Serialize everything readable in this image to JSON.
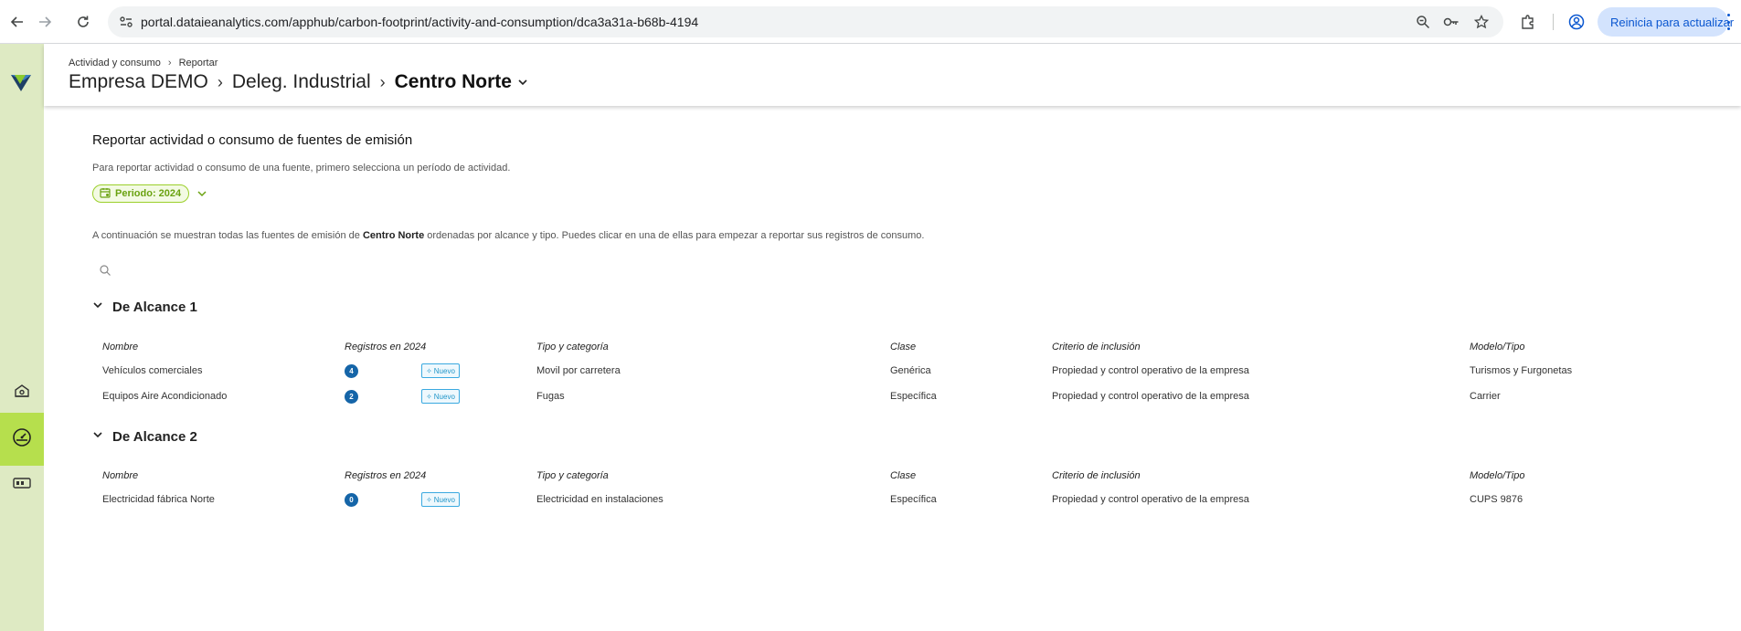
{
  "browser": {
    "url": "portal.dataieanalytics.com/apphub/carbon-footprint/activity-and-consumption/dca3a31a-b68b-4194",
    "update_label": "Reinicia para actualizar",
    "icons": [
      "back-icon",
      "forward-icon",
      "reload-icon",
      "site-info-icon",
      "zoom-icon",
      "password-key-icon",
      "bookmark-star-icon",
      "extensions-icon",
      "profile-icon",
      "menu-icon"
    ]
  },
  "rail": {
    "icons": [
      "brand-logo-icon",
      "home-icon",
      "dashboard-gauge-icon",
      "card-icon"
    ]
  },
  "header": {
    "crumb_small_1": "Actividad y consumo",
    "crumb_small_2": "Reportar",
    "crumb_1": "Empresa DEMO",
    "crumb_2": "Deleg. Industrial",
    "crumb_current": "Centro Norte"
  },
  "main": {
    "title": "Reportar actividad o consumo de fuentes de emisión",
    "description": "Para reportar actividad o consumo de una fuente, primero selecciona un período de actividad.",
    "period_label": "Periodo: 2024",
    "info_prefix": "A continuación se muestran todas las fuentes de emisión de ",
    "info_center": "Centro Norte",
    "info_suffix": " ordenadas por alcance y tipo. Puedes clicar en una de ellas para empezar a reportar sus registros de consumo.",
    "search_value": ""
  },
  "columns": {
    "name": "Nombre",
    "records": "Registros en 2024",
    "type": "Tipo y categoría",
    "class": "Clase",
    "criteria": "Criterio de inclusión",
    "model": "Modelo/Tipo"
  },
  "groups": [
    {
      "title": "De Alcance 1",
      "rows": [
        {
          "name": "Vehículos comerciales",
          "count": "4",
          "badge": "Nuevo",
          "type": "Movil por carretera",
          "class": "Genérica",
          "criteria": "Propiedad y control operativo de la empresa",
          "model": "Turismos y Furgonetas"
        },
        {
          "name": "Equipos Aire Acondicionado",
          "count": "2",
          "badge": "Nuevo",
          "type": "Fugas",
          "class": "Específica",
          "criteria": "Propiedad y control operativo de la empresa",
          "model": "Carrier"
        }
      ]
    },
    {
      "title": "De Alcance 2",
      "rows": [
        {
          "name": "Electricidad fábrica Norte",
          "count": "0",
          "badge": "Nuevo",
          "type": "Electricidad en instalaciones",
          "class": "Específica",
          "criteria": "Propiedad y control operativo de la empresa",
          "model": "CUPS 9876"
        }
      ]
    }
  ],
  "colors": {
    "rail_bg": "#deeac3",
    "rail_active": "#b6df4d",
    "accent_green": "#6aa210",
    "badge_blue": "#1565a8",
    "new_badge_blue": "#2196c9"
  }
}
